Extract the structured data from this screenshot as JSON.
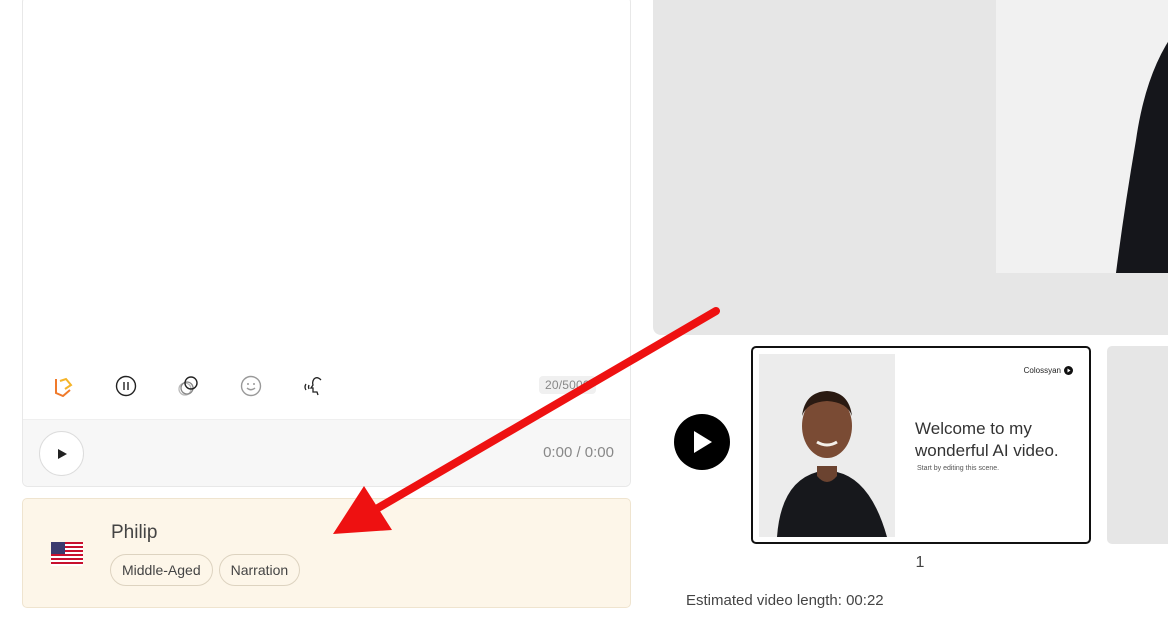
{
  "editor": {
    "char_count": "20/5000",
    "toolbar": [
      {
        "name": "colossyan-logo-icon"
      },
      {
        "name": "pause-icon"
      },
      {
        "name": "overlay-icon"
      },
      {
        "name": "emoji-icon"
      },
      {
        "name": "voice-icon"
      }
    ],
    "player": {
      "time": "0:00 / 0:00"
    }
  },
  "voice": {
    "flag": "us-flag-icon",
    "name": "Philip",
    "tags": [
      "Middle-Aged",
      "Narration"
    ]
  },
  "timeline": {
    "scenes": [
      {
        "number": "1",
        "logo": "Colossyan",
        "title": "Welcome to my wonderful AI video.",
        "subtitle": "Start by editing this scene."
      }
    ],
    "estimated_length": "Estimated video length: 00:22"
  },
  "colors": {
    "accent_arrow": "#ee1111",
    "voice_card_bg": "#fdf6e9"
  }
}
